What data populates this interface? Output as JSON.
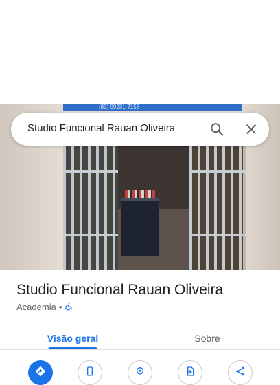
{
  "search": {
    "query": "Studio Funcional Rauan Oliveira"
  },
  "photo": {
    "banner_text": "(83) 99231-7156"
  },
  "place": {
    "name": "Studio Funcional Rauan Oliveira",
    "category": "Academia",
    "separator": "•"
  },
  "tabs": [
    {
      "label": "Visão geral",
      "active": true
    },
    {
      "label": "Sobre",
      "active": false
    }
  ],
  "actions": [
    {
      "icon": "directions-icon"
    },
    {
      "icon": "phone-icon"
    },
    {
      "icon": "location-icon"
    },
    {
      "icon": "save-icon"
    },
    {
      "icon": "share-icon"
    }
  ],
  "colors": {
    "accent": "#1a73e8",
    "text_primary": "#202124",
    "text_secondary": "#5f6368"
  }
}
